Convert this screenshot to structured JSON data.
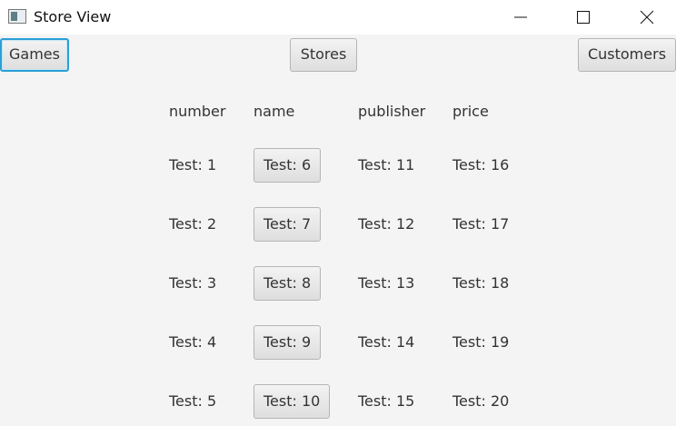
{
  "window": {
    "title": "Store View",
    "controls": [
      "minimize",
      "maximize",
      "close"
    ]
  },
  "nav": {
    "games_label": "Games",
    "stores_label": "Stores",
    "customers_label": "Customers"
  },
  "table": {
    "headers": {
      "number": "number",
      "name": "name",
      "publisher": "publisher",
      "price": "price"
    },
    "rows": [
      {
        "number": "Test: 1",
        "name": "Test: 6",
        "publisher": "Test: 11",
        "price": "Test: 16"
      },
      {
        "number": "Test: 2",
        "name": "Test: 7",
        "publisher": "Test: 12",
        "price": "Test: 17"
      },
      {
        "number": "Test: 3",
        "name": "Test: 8",
        "publisher": "Test: 13",
        "price": "Test: 18"
      },
      {
        "number": "Test: 4",
        "name": "Test: 9",
        "publisher": "Test: 14",
        "price": "Test: 19"
      },
      {
        "number": "Test: 5",
        "name": "Test: 10",
        "publisher": "Test: 15",
        "price": "Test: 20"
      }
    ]
  },
  "colors": {
    "focus_border": "#2a9fd6",
    "background": "#f4f4f4",
    "titlebar": "#ffffff"
  }
}
